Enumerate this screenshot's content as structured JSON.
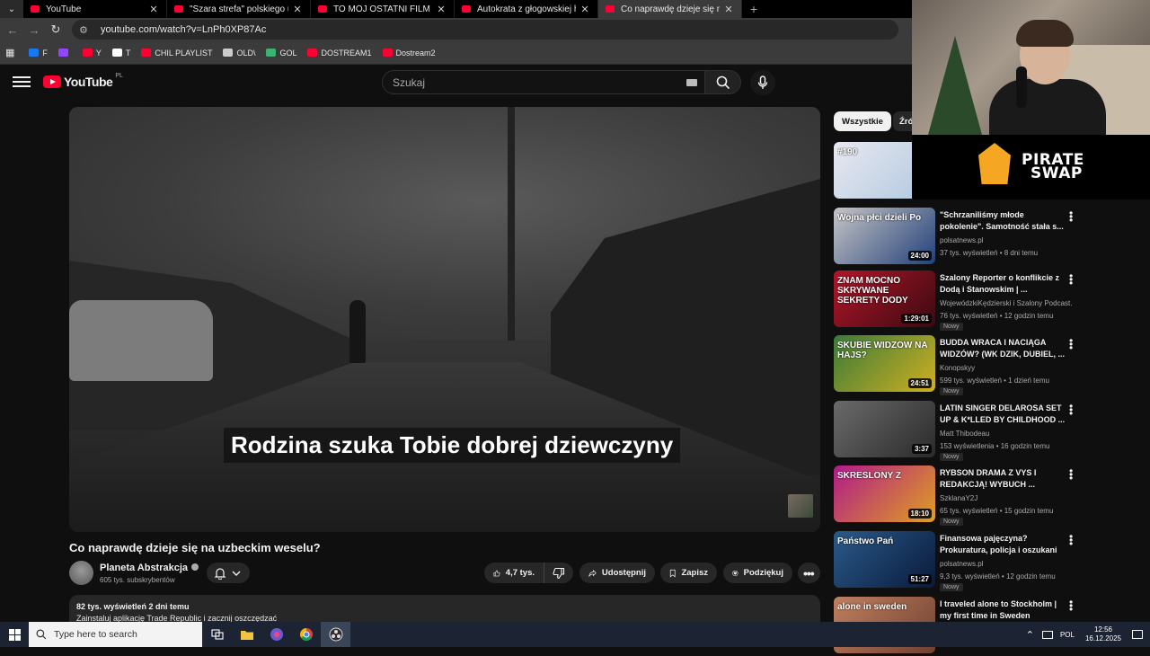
{
  "browser": {
    "tabs": [
      {
        "title": "YouTube",
        "active": false
      },
      {
        "title": "\"Szara strefa\" polskiego ubóstw",
        "active": false
      },
      {
        "title": "TO MÓJ OSTATNI FILM O FAZIE",
        "active": false
      },
      {
        "title": "Autokrata z głogowskiej huty w",
        "active": false
      },
      {
        "title": "Co naprawdę dzieje się na uzbe",
        "active": true
      }
    ],
    "url": "youtube.com/watch?v=LnPh0XP87Ac",
    "bookmarks": [
      {
        "label": "F",
        "color": "#1877f2"
      },
      {
        "label": "",
        "color": "#9146ff"
      },
      {
        "label": "Y",
        "color": "#ff0033"
      },
      {
        "label": "T",
        "color": "#ffffff"
      },
      {
        "label": "CHIL PLAYLIST",
        "color": "#ff0033"
      },
      {
        "label": "OLD\\",
        "color": "#cccccc"
      },
      {
        "label": "GOL",
        "color": "#3cb371"
      },
      {
        "label": "DOSTREAM1",
        "color": "#ff0033"
      },
      {
        "label": "Dostream2",
        "color": "#ff0033"
      }
    ]
  },
  "youtube": {
    "logo_text": "YouTube",
    "country_code": "PL",
    "search_placeholder": "Szukaj"
  },
  "video": {
    "subtitle": "Rodzina szuka Tobie dobrej dziewczyny",
    "title": "Co naprawdę dzieje się na uzbeckim weselu?",
    "channel": "Planeta Abstrakcja",
    "subscribers": "605 tys. subskrybentów",
    "likes": "4,7 tys.",
    "share_label": "Udostępnij",
    "save_label": "Zapisz",
    "thanks_label": "Podziękuj",
    "views_line": "82 tys. wyświetleń  2 dni temu",
    "description_line": "Zainstaluj aplikację Trade Republic i zacznij oszczędzać"
  },
  "sidebar": {
    "chips": [
      "Wszystkie",
      "Źró"
    ],
    "recommendations": [
      {
        "title": "",
        "channel": "",
        "meta": "",
        "duration": "",
        "new": false,
        "thumb_text": "#190",
        "colors": [
          "#e8e8f0",
          "#b0c8e0"
        ]
      },
      {
        "title": "\"Schrzaniliśmy młode pokolenie\". Samotność stała s...",
        "channel": "polsatnews.pl",
        "meta": "37 tys. wyświetleń • 8 dni temu",
        "duration": "24:00",
        "new": false,
        "thumb_text": "Wojna płci dzieli Po",
        "colors": [
          "#c5c5c5",
          "#23407a"
        ]
      },
      {
        "title": "Szalony Reporter o konflikcie z Dodą i Stanowskim | ...",
        "channel": "WojewódzkiKędzierski i Szalony Podcast.",
        "meta": "76 tys. wyświetleń • 12 godzin temu",
        "duration": "1:29:01",
        "new": true,
        "thumb_text": "ZNAM MOCNO SKRYWANE SEKRETY DODY",
        "colors": [
          "#b2152a",
          "#3a0a10"
        ]
      },
      {
        "title": "BUDDA WRACA I NACIĄGA WIDZÓW? (WK DZIK, DUBIEL, ...",
        "channel": "Konopskyy",
        "meta": "599 tys. wyświetleń • 1 dzień temu",
        "duration": "24:51",
        "new": true,
        "thumb_text": "SKUBIE WIDZÓW NA HAJS?",
        "colors": [
          "#3a7a3a",
          "#d0b020"
        ]
      },
      {
        "title": "LATIN SINGER DELAROSA SET UP & K*LLED BY CHILDHOOD ...",
        "channel": "Matt Thibodeau",
        "meta": "153 wyświetlenia • 16 godzin temu",
        "duration": "3:37",
        "new": true,
        "thumb_text": "",
        "colors": [
          "#6a6a6a",
          "#2a2a2a"
        ]
      },
      {
        "title": "RYBSON DRAMA Z VYS I REDAKCJĄ! WYBUCH ...",
        "channel": "SzklanaY2J",
        "meta": "65 tys. wyświetleń • 15 godzin temu",
        "duration": "18:10",
        "new": true,
        "thumb_text": "SKREŚLONY Z",
        "colors": [
          "#b01a8a",
          "#e0a020"
        ]
      },
      {
        "title": "Finansowa pajęczyna? Prokuratura, policja i oszukani ...",
        "channel": "polsatnews.pl",
        "meta": "9,3 tys. wyświetleń • 12 godzin temu",
        "duration": "51:27",
        "new": true,
        "thumb_text": "Państwo Pań",
        "colors": [
          "#2a5a8a",
          "#0a1a3a"
        ]
      },
      {
        "title": "I traveled alone to Stockholm | my first time in Sweden",
        "channel": "",
        "meta": "",
        "duration": "",
        "new": false,
        "thumb_text": "alone in sweden",
        "colors": [
          "#c08060",
          "#704030"
        ]
      }
    ]
  },
  "overlay": {
    "sponsor_brand_line1": "PIRATE",
    "sponsor_brand_line2": "SWAP"
  },
  "taskbar": {
    "search_placeholder": "Type here to search",
    "language": "POL",
    "time": "12:56",
    "date": "16.12.2025"
  }
}
